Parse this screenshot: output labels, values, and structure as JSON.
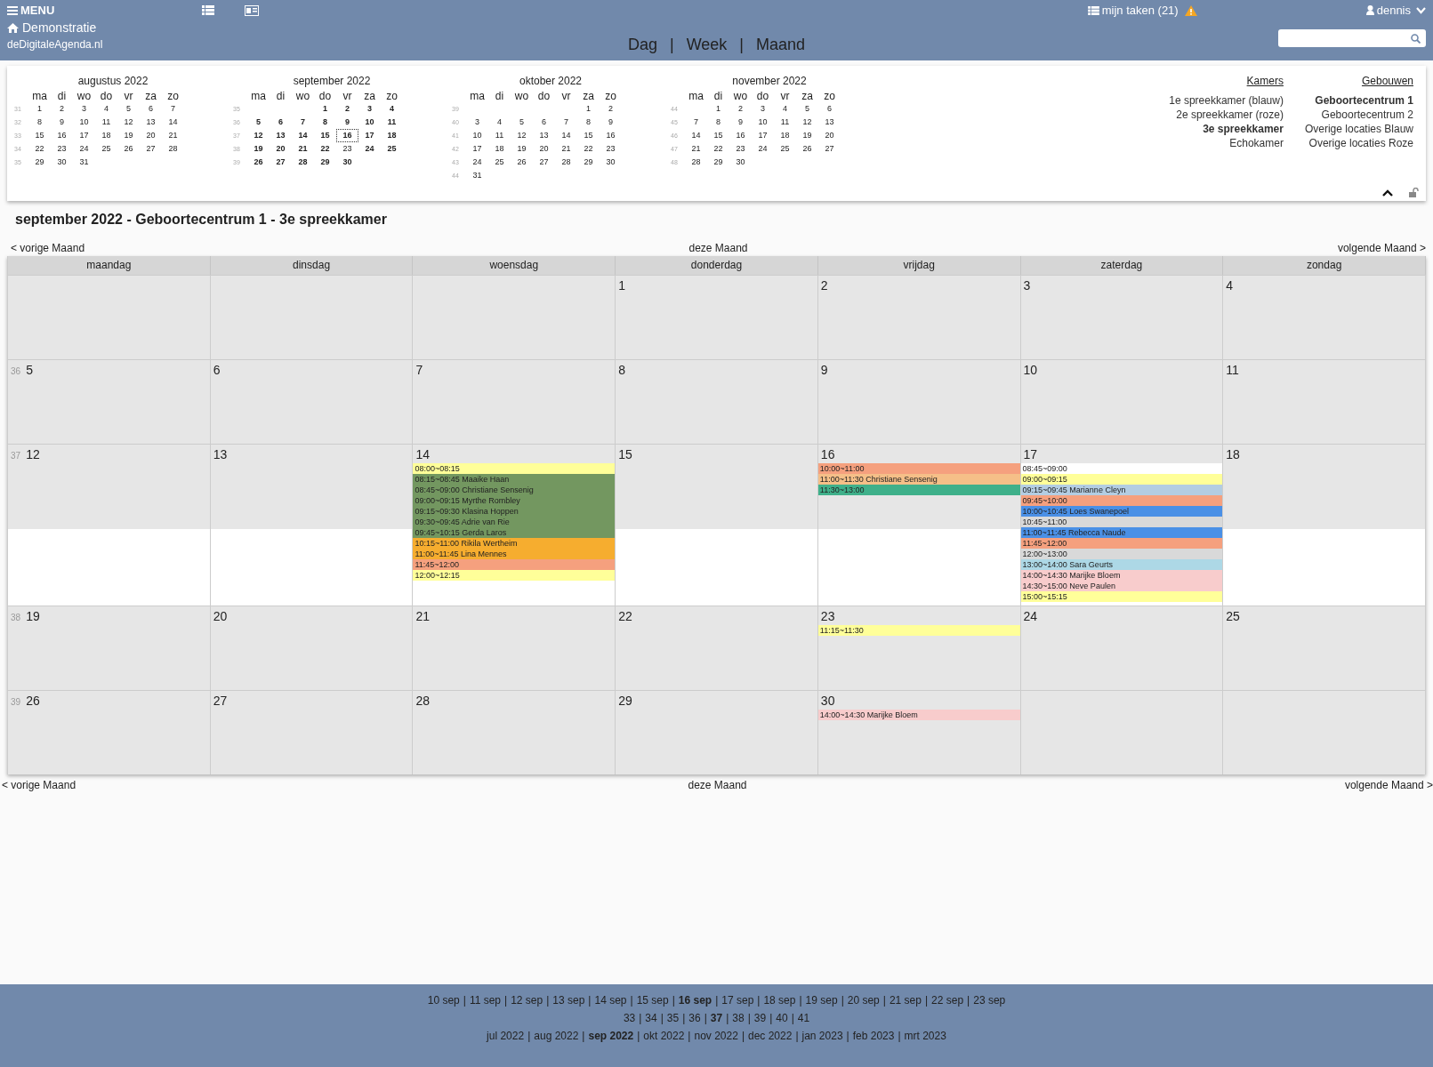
{
  "header": {
    "menu": "MENU",
    "tasks": "mijn taken (21)",
    "user": "dennis",
    "brand": "Demonstratie",
    "site": "deDigitaleAgenda.nl",
    "views": [
      "Dag",
      "Week",
      "Maand"
    ],
    "view_separator": "|"
  },
  "mini_calendars": [
    {
      "title": "augustus 2022",
      "weekdays": [
        "ma",
        "di",
        "wo",
        "do",
        "vr",
        "za",
        "zo"
      ],
      "weeks": [
        {
          "week": "31",
          "days": [
            {
              "d": "1",
              "bold": false,
              "selected": false
            },
            {
              "d": "2",
              "bold": false,
              "selected": false
            },
            {
              "d": "3",
              "bold": false,
              "selected": false
            },
            {
              "d": "4",
              "bold": false,
              "selected": false
            },
            {
              "d": "5",
              "bold": false,
              "selected": false
            },
            {
              "d": "6",
              "bold": false,
              "selected": false
            },
            {
              "d": "7",
              "bold": false,
              "selected": false
            }
          ]
        },
        {
          "week": "32",
          "days": [
            {
              "d": "8",
              "bold": false,
              "selected": false
            },
            {
              "d": "9",
              "bold": false,
              "selected": false
            },
            {
              "d": "10",
              "bold": false,
              "selected": false
            },
            {
              "d": "11",
              "bold": false,
              "selected": false
            },
            {
              "d": "12",
              "bold": false,
              "selected": false
            },
            {
              "d": "13",
              "bold": false,
              "selected": false
            },
            {
              "d": "14",
              "bold": false,
              "selected": false
            }
          ]
        },
        {
          "week": "33",
          "days": [
            {
              "d": "15",
              "bold": false,
              "selected": false
            },
            {
              "d": "16",
              "bold": false,
              "selected": false
            },
            {
              "d": "17",
              "bold": false,
              "selected": false
            },
            {
              "d": "18",
              "bold": false,
              "selected": false
            },
            {
              "d": "19",
              "bold": false,
              "selected": false
            },
            {
              "d": "20",
              "bold": false,
              "selected": false
            },
            {
              "d": "21",
              "bold": false,
              "selected": false
            }
          ]
        },
        {
          "week": "34",
          "days": [
            {
              "d": "22",
              "bold": false,
              "selected": false
            },
            {
              "d": "23",
              "bold": false,
              "selected": false
            },
            {
              "d": "24",
              "bold": false,
              "selected": false
            },
            {
              "d": "25",
              "bold": false,
              "selected": false
            },
            {
              "d": "26",
              "bold": false,
              "selected": false
            },
            {
              "d": "27",
              "bold": false,
              "selected": false
            },
            {
              "d": "28",
              "bold": false,
              "selected": false
            }
          ]
        },
        {
          "week": "35",
          "days": [
            {
              "d": "29",
              "bold": false,
              "selected": false
            },
            {
              "d": "30",
              "bold": false,
              "selected": false
            },
            {
              "d": "31",
              "bold": false,
              "selected": false
            }
          ]
        }
      ]
    },
    {
      "title": "september 2022",
      "weekdays": [
        "ma",
        "di",
        "wo",
        "do",
        "vr",
        "za",
        "zo"
      ],
      "weeks": [
        {
          "week": "35",
          "right_aligned": true,
          "days": [
            {
              "d": "1",
              "bold": true,
              "selected": false
            },
            {
              "d": "2",
              "bold": true,
              "selected": false
            },
            {
              "d": "3",
              "bold": true,
              "selected": false
            },
            {
              "d": "4",
              "bold": true,
              "selected": false
            }
          ]
        },
        {
          "week": "36",
          "days": [
            {
              "d": "5",
              "bold": true,
              "selected": false
            },
            {
              "d": "6",
              "bold": true,
              "selected": false
            },
            {
              "d": "7",
              "bold": true,
              "selected": false
            },
            {
              "d": "8",
              "bold": true,
              "selected": false
            },
            {
              "d": "9",
              "bold": true,
              "selected": false
            },
            {
              "d": "10",
              "bold": true,
              "selected": false
            },
            {
              "d": "11",
              "bold": true,
              "selected": false
            }
          ]
        },
        {
          "week": "37",
          "days": [
            {
              "d": "12",
              "bold": true,
              "selected": false
            },
            {
              "d": "13",
              "bold": true,
              "selected": false
            },
            {
              "d": "14",
              "bold": true,
              "selected": false
            },
            {
              "d": "15",
              "bold": true,
              "selected": false
            },
            {
              "d": "16",
              "bold": true,
              "selected": true
            },
            {
              "d": "17",
              "bold": true,
              "selected": false
            },
            {
              "d": "18",
              "bold": true,
              "selected": false
            }
          ]
        },
        {
          "week": "38",
          "days": [
            {
              "d": "19",
              "bold": true,
              "selected": false
            },
            {
              "d": "20",
              "bold": true,
              "selected": false
            },
            {
              "d": "21",
              "bold": true,
              "selected": false
            },
            {
              "d": "22",
              "bold": true,
              "selected": false
            },
            {
              "d": "23",
              "bold": false,
              "selected": false
            },
            {
              "d": "24",
              "bold": true,
              "selected": false
            },
            {
              "d": "25",
              "bold": true,
              "selected": false
            }
          ]
        },
        {
          "week": "39",
          "days": [
            {
              "d": "26",
              "bold": true,
              "selected": false
            },
            {
              "d": "27",
              "bold": true,
              "selected": false
            },
            {
              "d": "28",
              "bold": true,
              "selected": false
            },
            {
              "d": "29",
              "bold": true,
              "selected": false
            },
            {
              "d": "30",
              "bold": true,
              "selected": false
            }
          ]
        }
      ]
    },
    {
      "title": "oktober 2022",
      "weekdays": [
        "ma",
        "di",
        "wo",
        "do",
        "vr",
        "za",
        "zo"
      ],
      "weeks": [
        {
          "week": "39",
          "right_aligned": true,
          "days": [
            {
              "d": "1",
              "bold": false,
              "selected": false
            },
            {
              "d": "2",
              "bold": false,
              "selected": false
            }
          ]
        },
        {
          "week": "40",
          "days": [
            {
              "d": "3",
              "bold": false,
              "selected": false
            },
            {
              "d": "4",
              "bold": false,
              "selected": false
            },
            {
              "d": "5",
              "bold": false,
              "selected": false
            },
            {
              "d": "6",
              "bold": false,
              "selected": false
            },
            {
              "d": "7",
              "bold": false,
              "selected": false
            },
            {
              "d": "8",
              "bold": false,
              "selected": false
            },
            {
              "d": "9",
              "bold": false,
              "selected": false
            }
          ]
        },
        {
          "week": "41",
          "days": [
            {
              "d": "10",
              "bold": false,
              "selected": false
            },
            {
              "d": "11",
              "bold": false,
              "selected": false
            },
            {
              "d": "12",
              "bold": false,
              "selected": false
            },
            {
              "d": "13",
              "bold": false,
              "selected": false
            },
            {
              "d": "14",
              "bold": false,
              "selected": false
            },
            {
              "d": "15",
              "bold": false,
              "selected": false
            },
            {
              "d": "16",
              "bold": false,
              "selected": false
            }
          ]
        },
        {
          "week": "42",
          "days": [
            {
              "d": "17",
              "bold": false,
              "selected": false
            },
            {
              "d": "18",
              "bold": false,
              "selected": false
            },
            {
              "d": "19",
              "bold": false,
              "selected": false
            },
            {
              "d": "20",
              "bold": false,
              "selected": false
            },
            {
              "d": "21",
              "bold": false,
              "selected": false
            },
            {
              "d": "22",
              "bold": false,
              "selected": false
            },
            {
              "d": "23",
              "bold": false,
              "selected": false
            }
          ]
        },
        {
          "week": "43",
          "days": [
            {
              "d": "24",
              "bold": false,
              "selected": false
            },
            {
              "d": "25",
              "bold": false,
              "selected": false
            },
            {
              "d": "26",
              "bold": false,
              "selected": false
            },
            {
              "d": "27",
              "bold": false,
              "selected": false
            },
            {
              "d": "28",
              "bold": false,
              "selected": false
            },
            {
              "d": "29",
              "bold": false,
              "selected": false
            },
            {
              "d": "30",
              "bold": false,
              "selected": false
            }
          ]
        },
        {
          "week": "44",
          "days": [
            {
              "d": "31",
              "bold": false,
              "selected": false
            }
          ]
        }
      ]
    },
    {
      "title": "november 2022",
      "weekdays": [
        "ma",
        "di",
        "wo",
        "do",
        "vr",
        "za",
        "zo"
      ],
      "weeks": [
        {
          "week": "44",
          "right_aligned": true,
          "days": [
            {
              "d": "1",
              "bold": false,
              "selected": false
            },
            {
              "d": "2",
              "bold": false,
              "selected": false
            },
            {
              "d": "3",
              "bold": false,
              "selected": false
            },
            {
              "d": "4",
              "bold": false,
              "selected": false
            },
            {
              "d": "5",
              "bold": false,
              "selected": false
            },
            {
              "d": "6",
              "bold": false,
              "selected": false
            }
          ]
        },
        {
          "week": "45",
          "days": [
            {
              "d": "7",
              "bold": false,
              "selected": false
            },
            {
              "d": "8",
              "bold": false,
              "selected": false
            },
            {
              "d": "9",
              "bold": false,
              "selected": false
            },
            {
              "d": "10",
              "bold": false,
              "selected": false
            },
            {
              "d": "11",
              "bold": false,
              "selected": false
            },
            {
              "d": "12",
              "bold": false,
              "selected": false
            },
            {
              "d": "13",
              "bold": false,
              "selected": false
            }
          ]
        },
        {
          "week": "46",
          "days": [
            {
              "d": "14",
              "bold": false,
              "selected": false
            },
            {
              "d": "15",
              "bold": false,
              "selected": false
            },
            {
              "d": "16",
              "bold": false,
              "selected": false
            },
            {
              "d": "17",
              "bold": false,
              "selected": false
            },
            {
              "d": "18",
              "bold": false,
              "selected": false
            },
            {
              "d": "19",
              "bold": false,
              "selected": false
            },
            {
              "d": "20",
              "bold": false,
              "selected": false
            }
          ]
        },
        {
          "week": "47",
          "days": [
            {
              "d": "21",
              "bold": false,
              "selected": false
            },
            {
              "d": "22",
              "bold": false,
              "selected": false
            },
            {
              "d": "23",
              "bold": false,
              "selected": false
            },
            {
              "d": "24",
              "bold": false,
              "selected": false
            },
            {
              "d": "25",
              "bold": false,
              "selected": false
            },
            {
              "d": "26",
              "bold": false,
              "selected": false
            },
            {
              "d": "27",
              "bold": false,
              "selected": false
            }
          ]
        },
        {
          "week": "48",
          "days": [
            {
              "d": "28",
              "bold": false,
              "selected": false
            },
            {
              "d": "29",
              "bold": false,
              "selected": false
            },
            {
              "d": "30",
              "bold": false,
              "selected": false
            }
          ]
        }
      ]
    }
  ],
  "rooms": {
    "title": "Kamers",
    "items": [
      {
        "label": "1e spreekkamer (blauw)",
        "selected": false
      },
      {
        "label": "2e spreekkamer (roze)",
        "selected": false
      },
      {
        "label": "3e spreekkamer",
        "selected": true
      },
      {
        "label": "Echokamer",
        "selected": false
      }
    ]
  },
  "buildings": {
    "title": "Gebouwen",
    "items": [
      {
        "label": "Geboortecentrum 1",
        "selected": true
      },
      {
        "label": "Geboortecentrum 2",
        "selected": false
      },
      {
        "label": "Overige locaties Blauw",
        "selected": false
      },
      {
        "label": "Overige locaties Roze",
        "selected": false
      }
    ]
  },
  "page_title": "september 2022 - Geboortecentrum 1 - 3e spreekkamer",
  "nav_top": {
    "prev": "< vorige Maand",
    "current": "deze Maand",
    "next": "volgende Maand >"
  },
  "month": {
    "weekdays": [
      "maandag",
      "dinsdag",
      "woensdag",
      "donderdag",
      "vrijdag",
      "zaterdag",
      "zondag"
    ],
    "weeks": [
      {
        "right_aligned": true,
        "days": [
          {
            "date": "1"
          },
          {
            "date": "2"
          },
          {
            "date": "3"
          },
          {
            "date": "4"
          }
        ]
      },
      {
        "week": "36",
        "days": [
          {
            "date": "5"
          },
          {
            "date": "6"
          },
          {
            "date": "7"
          },
          {
            "date": "8"
          },
          {
            "date": "9"
          },
          {
            "date": "10"
          },
          {
            "date": "11"
          }
        ]
      },
      {
        "week": "37",
        "days": [
          {
            "date": "12"
          },
          {
            "date": "13"
          },
          {
            "date": "14",
            "events": [
              {
                "text": "08:00~08:15",
                "color": "#ffff99"
              },
              {
                "text": "08:15~08:45 Maaike Haan",
                "color": "#739760"
              },
              {
                "text": "08:45~09:00 Christiane Sensenig",
                "color": "#739760"
              },
              {
                "text": "09:00~09:15 Myrthe Rombley",
                "color": "#739760"
              },
              {
                "text": "09:15~09:30 Klasina Hoppen",
                "color": "#739760"
              },
              {
                "text": "09:30~09:45 Adrie van Rie",
                "color": "#739760"
              },
              {
                "text": "09:45~10:15 Gerda Laros",
                "color": "#739760"
              },
              {
                "text": "10:15~11:00 Rikila Wertheim",
                "color": "#f6ad2f"
              },
              {
                "text": "11:00~11:45 Lina Mennes",
                "color": "#f6ad2f"
              },
              {
                "text": "11:45~12:00",
                "color": "#f5a07e"
              },
              {
                "text": "12:00~12:15",
                "color": "#ffff99"
              }
            ]
          },
          {
            "date": "15"
          },
          {
            "date": "16",
            "events": [
              {
                "text": "10:00~11:00",
                "color": "#f5a07e"
              },
              {
                "text": "11:00~11:30 Christiane Sensenig",
                "color": "#f5bf88"
              },
              {
                "text": "11:30~13:00",
                "color": "#3fb08a"
              }
            ]
          },
          {
            "date": "17",
            "events": [
              {
                "text": "08:45~09:00",
                "color": "#ffffff"
              },
              {
                "text": "09:00~09:15",
                "color": "#ffff99"
              },
              {
                "text": "09:15~09:45 Marianne Cleyn",
                "color": "#b3cde2"
              },
              {
                "text": "09:45~10:00",
                "color": "#f5a07e"
              },
              {
                "text": "10:00~10:45 Loes Swanepoel",
                "color": "#4a90e6"
              },
              {
                "text": "10:45~11:00",
                "color": "#d9d9d9"
              },
              {
                "text": "11:00~11:45 Rebecca Naude",
                "color": "#4a90e6"
              },
              {
                "text": "11:45~12:00",
                "color": "#f5a07e"
              },
              {
                "text": "12:00~13:00",
                "color": "#d9d9d9"
              },
              {
                "text": "13:00~14:00 Sara Geurts",
                "color": "#add8e6"
              },
              {
                "text": "14:00~14:30 Marijke Bloem",
                "color": "#f8cccc"
              },
              {
                "text": "14:30~15:00 Neve Paulen",
                "color": "#f8cccc"
              },
              {
                "text": "15:00~15:15",
                "color": "#ffff99"
              }
            ]
          },
          {
            "date": "18"
          }
        ]
      },
      {
        "week": "38",
        "days": [
          {
            "date": "19"
          },
          {
            "date": "20"
          },
          {
            "date": "21"
          },
          {
            "date": "22"
          },
          {
            "date": "23",
            "events": [
              {
                "text": "11:15~11:30",
                "color": "#ffff99"
              }
            ]
          },
          {
            "date": "24"
          },
          {
            "date": "25"
          }
        ]
      },
      {
        "week": "39",
        "days": [
          {
            "date": "26"
          },
          {
            "date": "27"
          },
          {
            "date": "28"
          },
          {
            "date": "29"
          },
          {
            "date": "30",
            "events": [
              {
                "text": "14:00~14:30 Marijke Bloem",
                "color": "#f8cccc"
              }
            ]
          }
        ]
      }
    ]
  },
  "nav_bottom": {
    "prev": "< vorige Maand",
    "current": "deze Maand",
    "next": "volgende Maand >"
  },
  "footer": {
    "separator": "|",
    "days": [
      {
        "label": "10 sep",
        "selected": false
      },
      {
        "label": "11 sep",
        "selected": false
      },
      {
        "label": "12 sep",
        "selected": false
      },
      {
        "label": "13 sep",
        "selected": false
      },
      {
        "label": "14 sep",
        "selected": false
      },
      {
        "label": "15 sep",
        "selected": false
      },
      {
        "label": "16 sep",
        "selected": true
      },
      {
        "label": "17 sep",
        "selected": false
      },
      {
        "label": "18 sep",
        "selected": false
      },
      {
        "label": "19 sep",
        "selected": false
      },
      {
        "label": "20 sep",
        "selected": false
      },
      {
        "label": "21 sep",
        "selected": false
      },
      {
        "label": "22 sep",
        "selected": false
      },
      {
        "label": "23 sep",
        "selected": false
      }
    ],
    "weeks": [
      {
        "label": "33",
        "selected": false
      },
      {
        "label": "34",
        "selected": false
      },
      {
        "label": "35",
        "selected": false
      },
      {
        "label": "36",
        "selected": false
      },
      {
        "label": "37",
        "selected": true
      },
      {
        "label": "38",
        "selected": false
      },
      {
        "label": "39",
        "selected": false
      },
      {
        "label": "40",
        "selected": false
      },
      {
        "label": "41",
        "selected": false
      }
    ],
    "months": [
      {
        "label": "jul 2022",
        "selected": false
      },
      {
        "label": "aug 2022",
        "selected": false
      },
      {
        "label": "sep 2022",
        "selected": true
      },
      {
        "label": "okt 2022",
        "selected": false
      },
      {
        "label": "nov 2022",
        "selected": false
      },
      {
        "label": "dec 2022",
        "selected": false
      },
      {
        "label": "jan 2023",
        "selected": false
      },
      {
        "label": "feb 2023",
        "selected": false
      },
      {
        "label": "mrt 2023",
        "selected": false
      }
    ]
  }
}
